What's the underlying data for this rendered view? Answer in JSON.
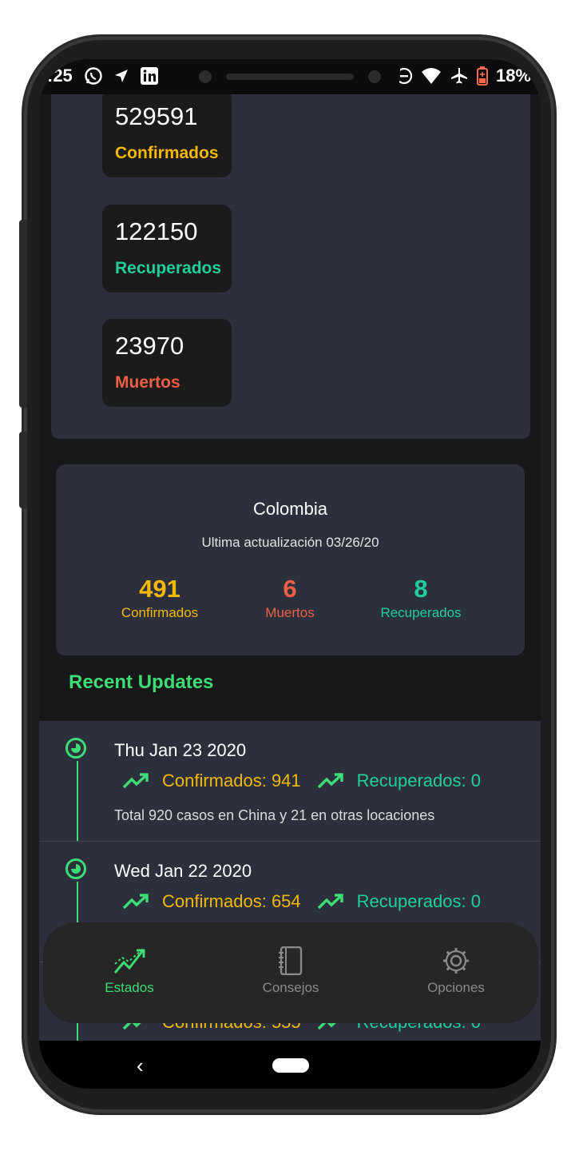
{
  "status_bar": {
    "time": ":25",
    "battery": "18",
    "battery_suffix": "%",
    "icons_left": [
      "whatsapp-icon",
      "navigation-icon",
      "linkedin-icon"
    ],
    "icons_right": [
      "dnd-icon",
      "wifi-icon",
      "airplane-icon",
      "battery-icon"
    ]
  },
  "global_stats": [
    {
      "value": "529591",
      "label": "Confirmados",
      "color": "#f5b800"
    },
    {
      "value": "122150",
      "label": "Recuperados",
      "color": "#1fcf9a"
    },
    {
      "value": "23970",
      "label": "Muertos",
      "color": "#ee5f45"
    }
  ],
  "country": {
    "name": "Colombia",
    "updated": "Ultima actualización 03/26/20",
    "stats": [
      {
        "value": "491",
        "label": "Confirmados",
        "color": "#f5b800"
      },
      {
        "value": "6",
        "label": "Muertos",
        "color": "#ee5f45"
      },
      {
        "value": "8",
        "label": "Recuperados",
        "color": "#1fcf9a"
      }
    ]
  },
  "recent": {
    "title": "Recent Updates",
    "items": [
      {
        "date": "Thu Jan 23 2020",
        "confirmed": "Confirmados: 941",
        "recovered": "Recuperados: 0",
        "desc": "Total 920 casos en China y 21 en otras locaciones"
      },
      {
        "date": "Wed Jan 22 2020",
        "confirmed": "Confirmados: 654",
        "recovered": "Recuperados: 0",
        "desc": ""
      },
      {
        "date": "",
        "confirmed": "Confirmados: 555",
        "recovered": "Recuperados: 0",
        "desc": ""
      }
    ]
  },
  "nav": {
    "items": [
      {
        "label": "Estados",
        "icon": "trend-chart-icon",
        "active": true
      },
      {
        "label": "Consejos",
        "icon": "notebook-icon",
        "active": false
      },
      {
        "label": "Opciones",
        "icon": "gear-icon",
        "active": false
      }
    ],
    "active_color": "#3ddc74",
    "inactive_color": "#8a8a8a"
  }
}
